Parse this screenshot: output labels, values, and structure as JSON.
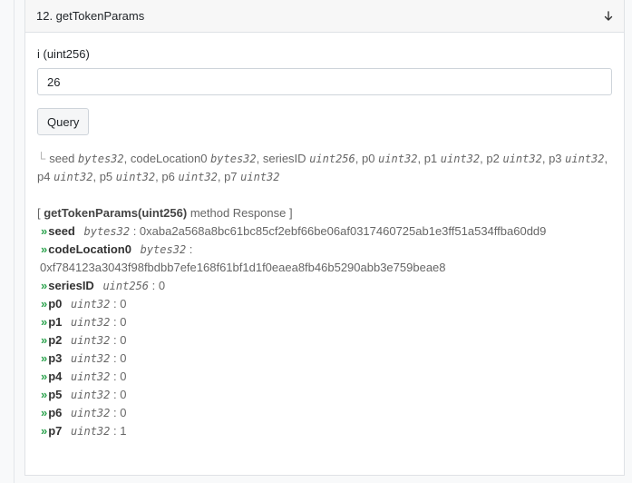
{
  "card": {
    "title": "12. getTokenParams",
    "collapse_icon": "chevron-down-icon"
  },
  "form": {
    "param_label": "i (uint256)",
    "param_value": "26",
    "query_label": "Query"
  },
  "signature": {
    "corner": "└",
    "params": [
      {
        "name": "seed",
        "type": "bytes32"
      },
      {
        "name": "codeLocation0",
        "type": "bytes32"
      },
      {
        "name": "seriesID",
        "type": "uint256"
      },
      {
        "name": "p0",
        "type": "uint32"
      },
      {
        "name": "p1",
        "type": "uint32"
      },
      {
        "name": "p2",
        "type": "uint32"
      },
      {
        "name": "p3",
        "type": "uint32"
      },
      {
        "name": "p4",
        "type": "uint32"
      },
      {
        "name": "p5",
        "type": "uint32"
      },
      {
        "name": "p6",
        "type": "uint32"
      },
      {
        "name": "p7",
        "type": "uint32"
      }
    ]
  },
  "response": {
    "open": "[ ",
    "method": "getTokenParams(uint256)",
    "suffix": " method Response ]",
    "arrow": "»",
    "rows": [
      {
        "name": "seed",
        "type": "bytes32",
        "value": "0xaba2a568a8bc61bc85cf2ebf66be06af0317460725ab1e3ff51a534ffba60dd9"
      },
      {
        "name": "codeLocation0",
        "type": "bytes32",
        "value": "0xf784123a3043f98fbdbb7efe168f61bf1d1f0eaea8fb46b5290abb3e759beae8",
        "wrap": true
      },
      {
        "name": "seriesID",
        "type": "uint256",
        "value": "0"
      },
      {
        "name": "p0",
        "type": "uint32",
        "value": "0"
      },
      {
        "name": "p1",
        "type": "uint32",
        "value": "0"
      },
      {
        "name": "p2",
        "type": "uint32",
        "value": "0"
      },
      {
        "name": "p3",
        "type": "uint32",
        "value": "0"
      },
      {
        "name": "p4",
        "type": "uint32",
        "value": "0"
      },
      {
        "name": "p5",
        "type": "uint32",
        "value": "0"
      },
      {
        "name": "p6",
        "type": "uint32",
        "value": "0"
      },
      {
        "name": "p7",
        "type": "uint32",
        "value": "1"
      }
    ]
  }
}
